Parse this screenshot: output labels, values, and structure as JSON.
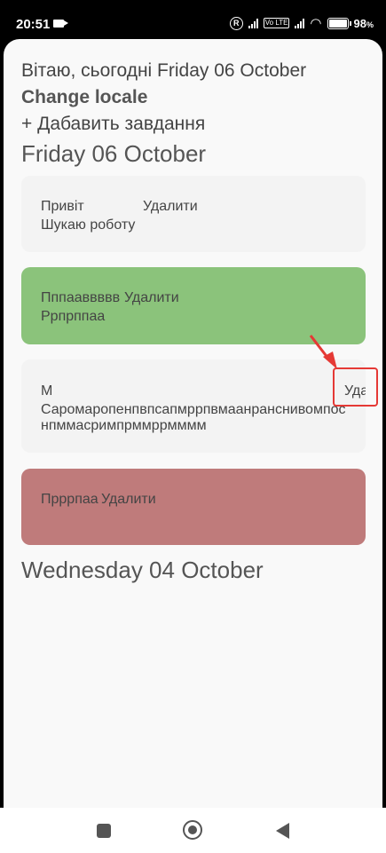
{
  "status_bar": {
    "time": "20:51",
    "battery_percent": "98",
    "battery_suffix": "%",
    "network_badge": "Vo LTE"
  },
  "header": {
    "greeting": "Вітаю, сьогодні Friday 06 October",
    "change_locale": "Change locale",
    "add_task": "+ Дабавить завдання"
  },
  "sections": [
    {
      "date": "Friday 06 October",
      "tasks": [
        {
          "title": "Привіт",
          "delete_label": "Удалити",
          "description": "Шукаю роботу",
          "color": "#f3f3f3"
        },
        {
          "title": "Пппааввввв",
          "delete_label": "Удалити",
          "description": "Ррпрппаа",
          "color": "#8bc37b"
        },
        {
          "title": "М",
          "delete_label": "Уда",
          "description": "Саромаропенпвпсапмррпвмаанранснивомпоснпммасримпрммррмммм",
          "color": "#f3f3f3"
        },
        {
          "title": "Прррпаа",
          "delete_label": "Удалити",
          "description": "",
          "color": "#bf7b7b"
        }
      ]
    },
    {
      "date": "Wednesday 04 October",
      "tasks": []
    }
  ],
  "annotation": {
    "color": "#e53935"
  }
}
